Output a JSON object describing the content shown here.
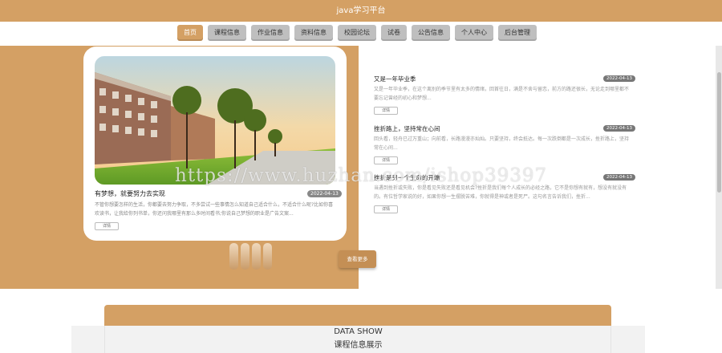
{
  "site": {
    "title": "java学习平台"
  },
  "nav": [
    {
      "label": "首页",
      "active": true
    },
    {
      "label": "课程信息",
      "active": false
    },
    {
      "label": "作业信息",
      "active": false
    },
    {
      "label": "资料信息",
      "active": false
    },
    {
      "label": "校园论坛",
      "active": false
    },
    {
      "label": "试卷",
      "active": false
    },
    {
      "label": "公告信息",
      "active": false
    },
    {
      "label": "个人中心",
      "active": false
    },
    {
      "label": "后台管理",
      "active": false
    }
  ],
  "feature": {
    "title": "有梦想，就要努力去实现",
    "date": "2022-04-13",
    "desc": "不管你想要怎样的生活，你都要去努力争取，不多尝试一些事情怎么知道自己适合什么，不适合什么呢?比如你喜欢读书，让我给你列书单，你还问我哪里有那么多时间看书;你说自己梦想的职业是广告文案...",
    "button": "详情"
  },
  "news": [
    {
      "title": "又是一年毕业季",
      "date": "2022-04-13",
      "desc": "又是一年毕业季，在这个离别的季节里有太多的情绪，回首往日，满是不舍与留恋，前方的路还很长，无论走到哪里都不要忘记曾经的初心和梦想...",
      "button": "详情"
    },
    {
      "title": "挫折路上，坚持常在心间",
      "date": "2022-04-13",
      "desc": "回头看，轻舟已过万重山；向前看，长路漫漫亦灿灿。只要坚持，终会抵达。每一次跌倒都是一次成长，挫折路上，坚持常在心间...",
      "button": "详情"
    },
    {
      "title": "挫折是另一个生命的开端",
      "date": "2022-04-13",
      "desc": "当遇到挫折或失败，你是看见失败还是看见机会?挫折是我们每个人成长的必经之路，它不是你想有就有，想没有就没有的。有位哲学家说的好，如果你想一生摆脱苦难，你就得是神或者是死尸。这句名言告诉我们，挫折...",
      "button": "详情"
    }
  ],
  "more_button": "查看更多",
  "watermark": "https://www.huzhan.com/ishop39397",
  "section": {
    "en": "DATA SHOW",
    "cn": "课程信息展示"
  },
  "colors": {
    "brand": "#d4a064",
    "nav_inactive": "#bfbfbf",
    "date_badge": "#777777"
  }
}
